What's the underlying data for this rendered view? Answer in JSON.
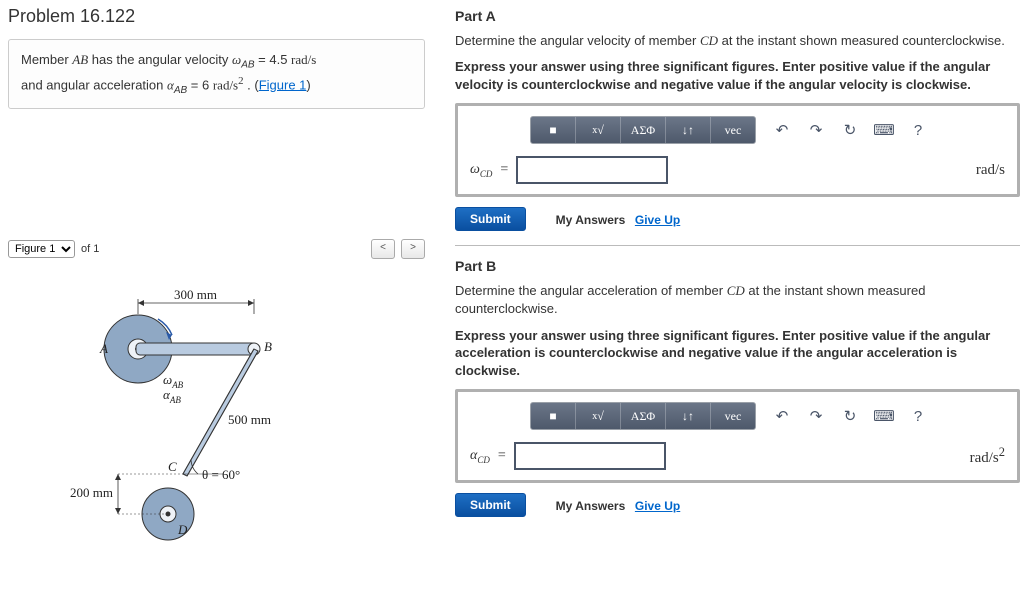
{
  "problem": {
    "title": "Problem 16.122",
    "statement_html_parts": {
      "p1a": "Member ",
      "p1b": "AB",
      "p1c": " has the angular velocity ",
      "p1d": "ω",
      "p1e": "AB",
      "p1f": " = 4.5 ",
      "p1g": "rad/s",
      "p2a": "and angular acceleration ",
      "p2b": "α",
      "p2c": "AB",
      "p2d": " = 6 ",
      "p2e": "rad/s",
      "p2f": "2",
      "p2g": " . (",
      "p2h": "Figure 1",
      "p2i": ")"
    }
  },
  "figure": {
    "selector_label": "Figure 1",
    "of_label": "of 1",
    "prev": "<",
    "next": ">",
    "dims": {
      "ab": "300 mm",
      "bc": "500 mm",
      "cd": "200 mm",
      "theta": "θ = 60°"
    },
    "points": {
      "a": "A",
      "b": "B",
      "c": "C",
      "d": "D"
    },
    "greek": {
      "omega": "ω",
      "alpha": "α",
      "sub": "AB"
    }
  },
  "partA": {
    "title": "Part A",
    "prompt_a": "Determine the angular velocity of member ",
    "prompt_cd": "CD",
    "prompt_b": " at the instant shown measured counterclockwise.",
    "instruction": "Express your answer using three significant figures. Enter positive value if the angular velocity is counterclockwise and negative value if the angular velocity is clockwise.",
    "variable": "ω",
    "varsub": "CD",
    "equals": "=",
    "unit": "rad/s"
  },
  "partB": {
    "title": "Part B",
    "prompt_a": "Determine the angular acceleration of member ",
    "prompt_cd": "CD",
    "prompt_b": " at the instant shown measured counterclockwise.",
    "instruction": "Express your answer using three significant figures. Enter positive value if the angular acceleration is counterclockwise and negative value if the angular acceleration is clockwise.",
    "variable": "α",
    "varsub": "CD",
    "equals": "=",
    "unit": "rad/s",
    "unitsup": "2"
  },
  "toolbar": {
    "templates": "■",
    "fraction": "√",
    "greek": "ΑΣΦ",
    "subscript": "↓↑",
    "vec": "vec",
    "undo": "↶",
    "redo": "↷",
    "reset": "↻",
    "keyboard": "⌨",
    "help": "?"
  },
  "actions": {
    "submit": "Submit",
    "my_answers": "My Answers",
    "give_up": "Give Up"
  }
}
